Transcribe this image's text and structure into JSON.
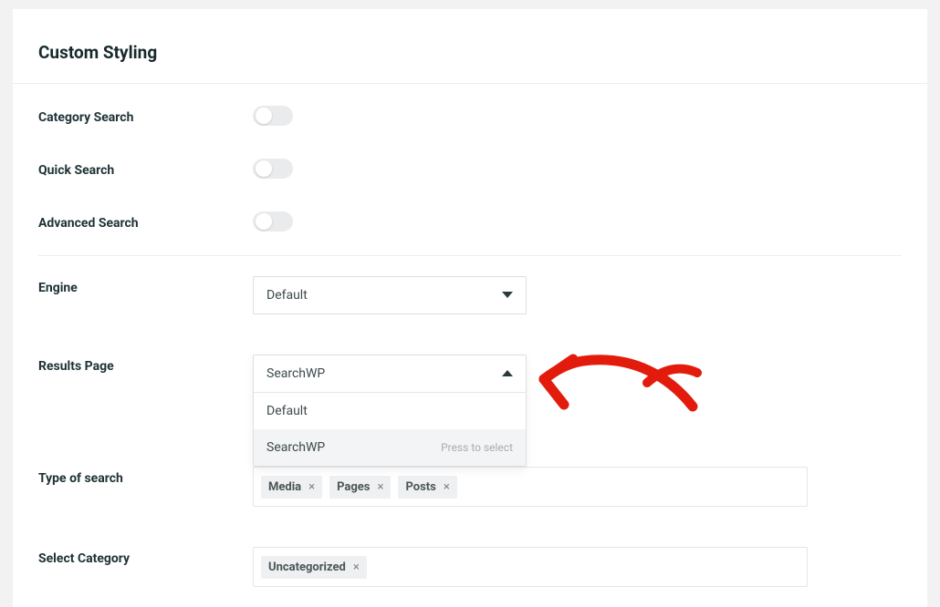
{
  "panel": {
    "title": "Custom Styling"
  },
  "rows": {
    "category_search": {
      "label": "Category Search",
      "on": false
    },
    "quick_search": {
      "label": "Quick Search",
      "on": false
    },
    "advanced_search": {
      "label": "Advanced Search",
      "on": false
    }
  },
  "engine": {
    "label": "Engine",
    "selected": "Default"
  },
  "results_page": {
    "label": "Results Page",
    "selected": "SearchWP",
    "options": [
      {
        "label": "Default",
        "highlight": false,
        "hint": ""
      },
      {
        "label": "SearchWP",
        "highlight": true,
        "hint": "Press to select"
      }
    ]
  },
  "type_of_search": {
    "label": "Type of search",
    "tags": [
      "Media",
      "Pages",
      "Posts"
    ]
  },
  "select_category": {
    "label": "Select Category",
    "tags": [
      "Uncategorized"
    ]
  },
  "annotation": {
    "color": "#e31b0c"
  }
}
